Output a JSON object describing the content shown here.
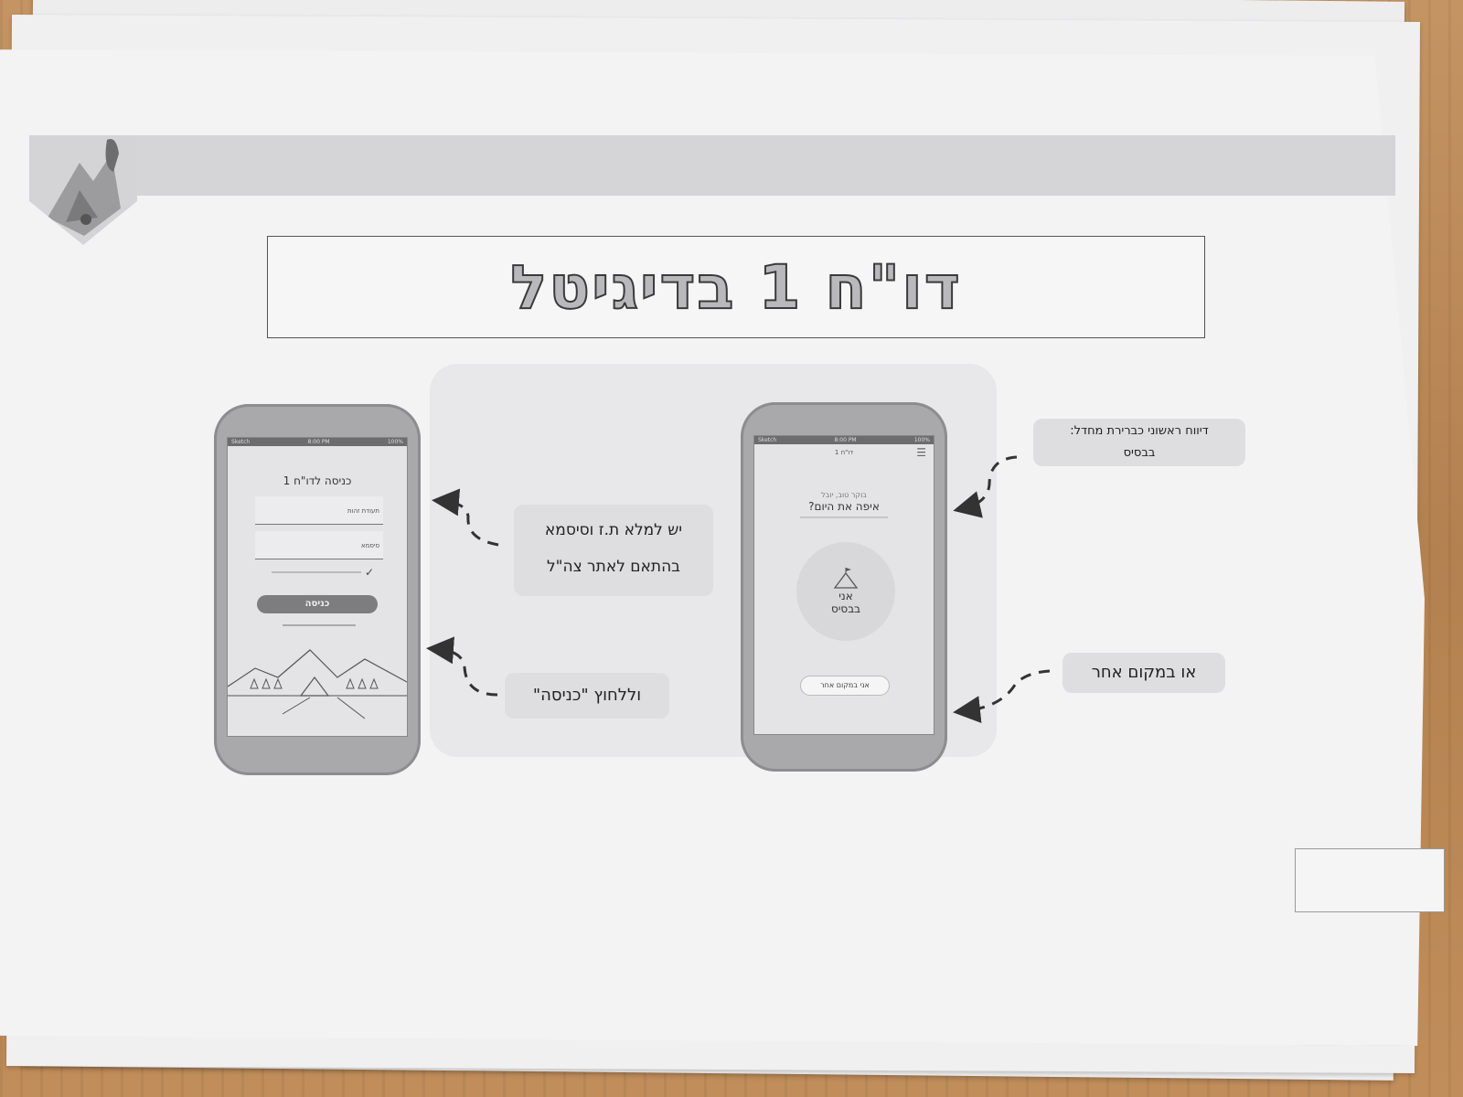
{
  "document": {
    "title": "דו\"ח 1 בדיגיטל"
  },
  "callouts": {
    "fill_id_1": "יש למלא ת.ז וסיסמא",
    "fill_id_2": "בהתאם לאתר צה\"ל",
    "press_enter": "וללחוץ \"כניסה\"",
    "initial_report_1": "דיווח ראשוני כברירת מחדל:",
    "initial_report_2": "בבסיס",
    "elsewhere": "או במקום אחר"
  },
  "login_phone": {
    "status_carrier": "Sketch",
    "status_time": "8:00 PM",
    "status_battery": "100%",
    "header": "כניסה לדו\"ח 1",
    "id_placeholder": "תעודת זהות",
    "password_placeholder": "סיסמא",
    "enter_button": "כניסה"
  },
  "home_phone": {
    "status_carrier": "Sketch",
    "status_time": "8:00 PM",
    "status_battery": "100%",
    "header": "דו\"ח 1",
    "greeting": "בוקר טוב, יובל",
    "question": "איפה את היום?",
    "in_base_1": "אני",
    "in_base_2": "בבסיס",
    "elsewhere_button": "אני במקום אחר"
  },
  "colors": {
    "paper": "#f3f3f4",
    "band": "#d5d5d7",
    "wood": "#b98a55"
  },
  "icons": [
    "emblem-icon",
    "mountain-flag-icon",
    "menu-icon",
    "checkmark-icon",
    "camp-illustration-icon"
  ]
}
